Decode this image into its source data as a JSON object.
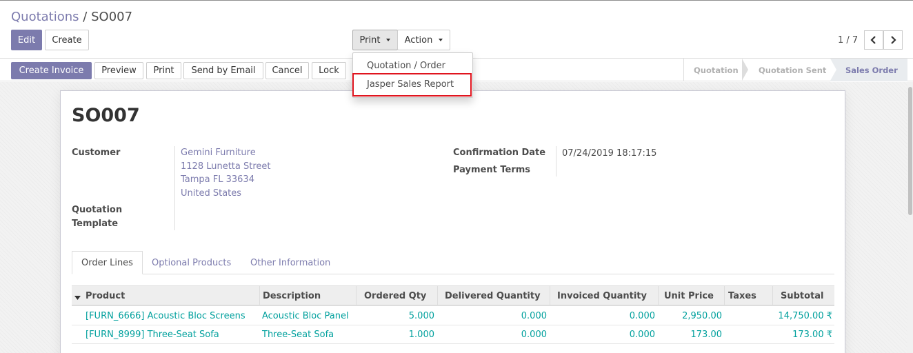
{
  "breadcrumb": {
    "parent": "Quotations",
    "separator": "/",
    "current": "SO007"
  },
  "toolbar": {
    "edit_label": "Edit",
    "create_label": "Create",
    "print_label": "Print",
    "action_label": "Action"
  },
  "pager": {
    "value": "1 / 7"
  },
  "print_menu": {
    "items": [
      "Quotation / Order",
      "Jasper Sales Report"
    ],
    "highlighted": "Jasper Sales Report",
    "highlight_color": "#e0141e"
  },
  "statusbar": {
    "buttons": [
      "Create Invoice",
      "Preview",
      "Print",
      "Send by Email",
      "Cancel",
      "Lock"
    ],
    "stages": [
      "Quotation",
      "Quotation Sent",
      "Sales Order"
    ],
    "current_stage": "Sales Order"
  },
  "form": {
    "name": "SO007",
    "customer_label": "Customer",
    "customer": {
      "name": "Gemini Furniture",
      "street": "1128 Lunetta Street",
      "city_line": "Tampa FL 33634",
      "country": "United States"
    },
    "quotation_template_label_1": "Quotation",
    "quotation_template_label_2": "Template",
    "confirmation_date_label": "Confirmation Date",
    "confirmation_date": "07/24/2019 18:17:15",
    "payment_terms_label": "Payment Terms"
  },
  "tabs": [
    "Order Lines",
    "Optional Products",
    "Other Information"
  ],
  "active_tab": "Order Lines",
  "table": {
    "columns": [
      "Product",
      "Description",
      "Ordered Qty",
      "Delivered Quantity",
      "Invoiced Quantity",
      "Unit Price",
      "Taxes",
      "Subtotal"
    ],
    "rows": [
      {
        "product": "[FURN_6666] Acoustic Bloc Screens",
        "description": "Acoustic Bloc Panel",
        "ordered": "5.000",
        "delivered": "0.000",
        "invoiced": "0.000",
        "unit_price": "2,950.00",
        "taxes": "",
        "subtotal": "14,750.00 ₹"
      },
      {
        "product": "[FURN_8999] Three-Seat Sofa",
        "description": "Three-Seat Sofa",
        "ordered": "1.000",
        "delivered": "0.000",
        "invoiced": "0.000",
        "unit_price": "173.00",
        "taxes": "",
        "subtotal": "173.00 ₹"
      }
    ]
  },
  "colors": {
    "primary": "#7c7bad",
    "link": "#00a09d",
    "text": "#4c4c4c"
  }
}
